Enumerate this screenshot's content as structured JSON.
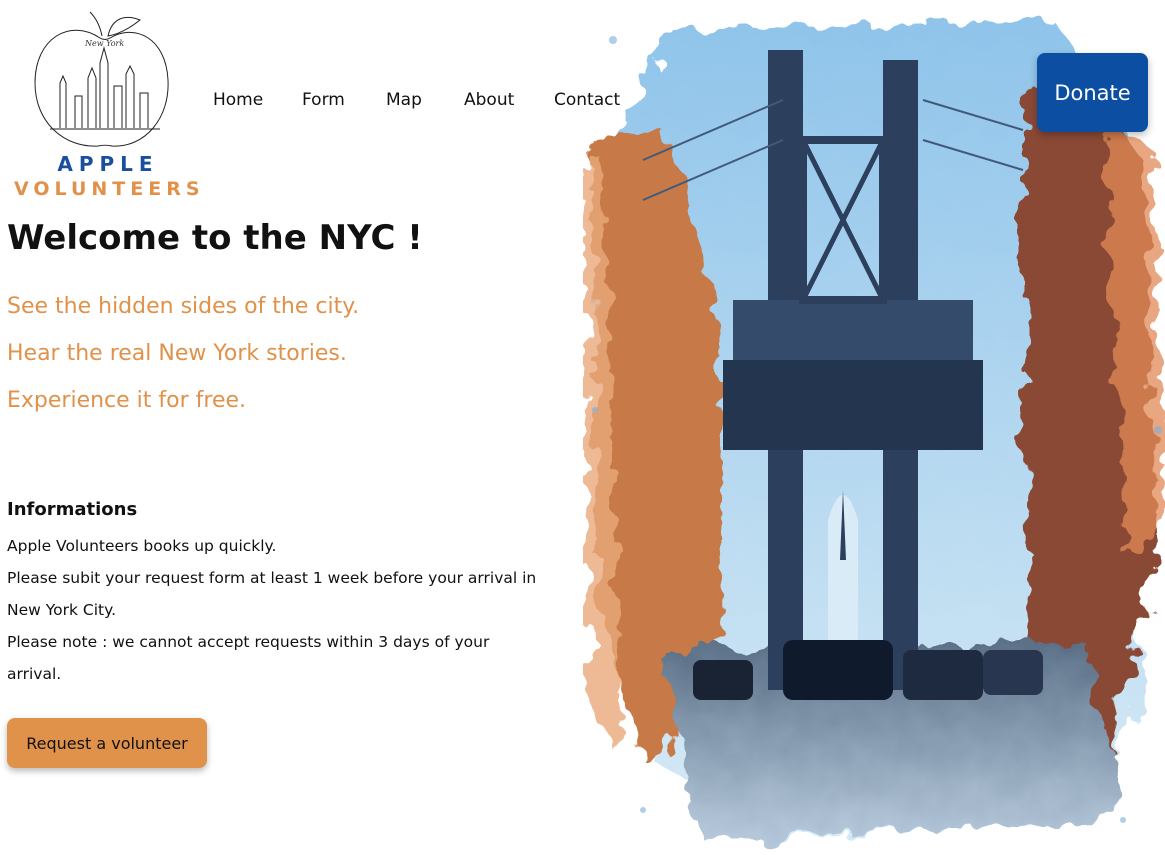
{
  "logo": {
    "line1": "APPLE",
    "line2": "VOLUNTEERS",
    "script_text": "New York"
  },
  "nav": {
    "items": [
      "Home",
      "Form",
      "Map",
      "About",
      "Contact"
    ]
  },
  "donate": {
    "label": "Donate"
  },
  "hero": {
    "title": "Welcome to the NYC !",
    "taglines": [
      "See the hidden sides of the city.",
      "Hear the real New York stories.",
      "Experience it for free."
    ]
  },
  "info": {
    "heading": "Informations",
    "lines": [
      "Apple Volunteers books up quickly.",
      "Please subit your request form at least 1 week before your arrival in",
      "New York City.",
      "Please note : we cannot accept requests within 3 days of your",
      "arrival."
    ]
  },
  "cta": {
    "label": "Request a volunteer"
  },
  "colors": {
    "brand_blue": "#1a4fa0",
    "accent_orange": "#e0914a",
    "donate_blue": "#0b4ea2",
    "text": "#111111"
  },
  "illustration": {
    "subject": "watercolor-manhattan-bridge-street"
  }
}
